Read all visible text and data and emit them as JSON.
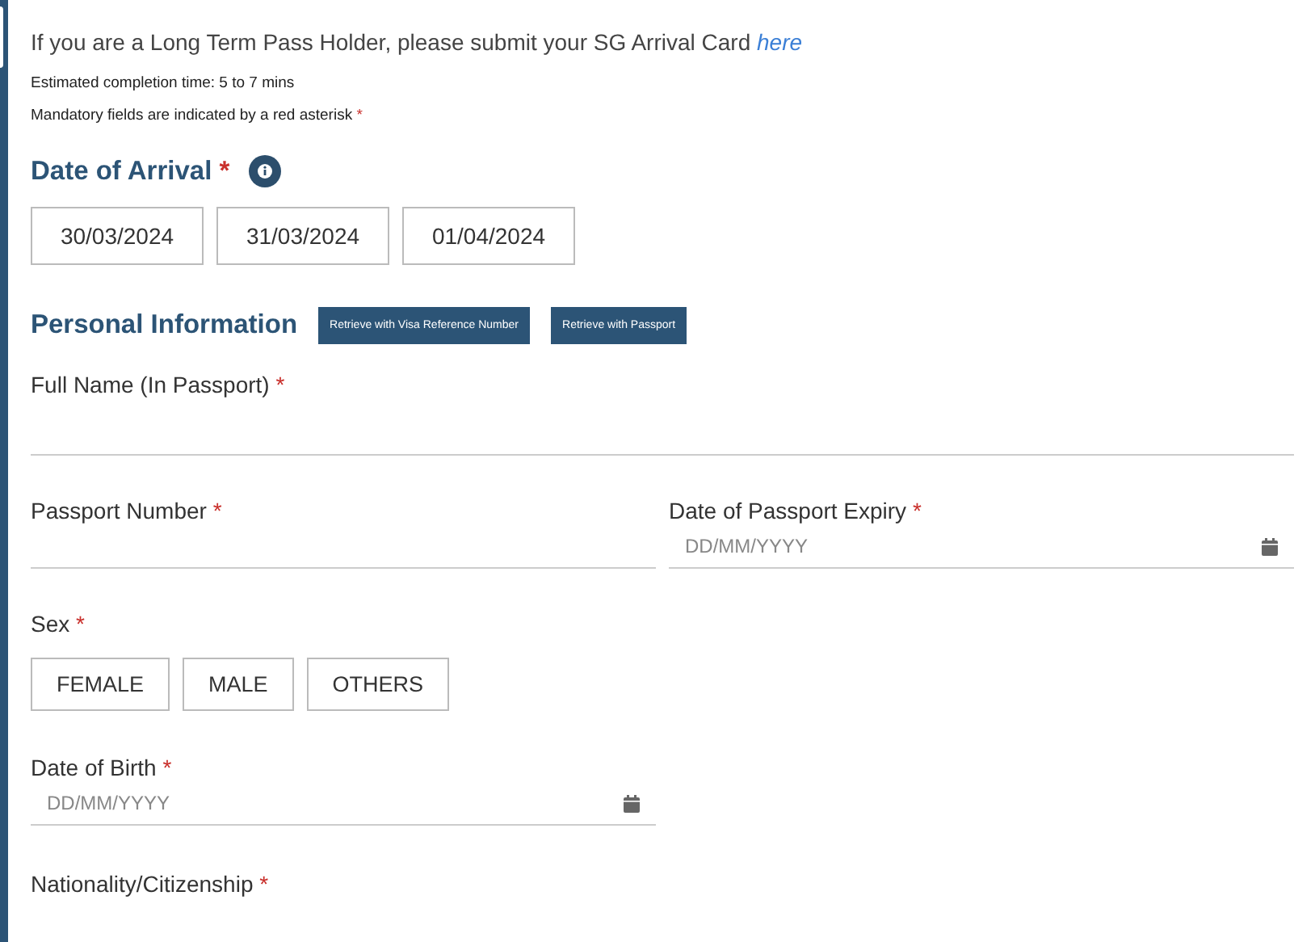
{
  "intro": {
    "text": "If you are a Long Term Pass Holder, please submit your SG Arrival Card ",
    "link": "here"
  },
  "estimate": "Estimated completion time: 5 to 7 mins",
  "mandatory_note": {
    "text": "Mandatory fields are indicated by a red asterisk",
    "mark": "*"
  },
  "arrival": {
    "title": "Date of Arrival",
    "mark": "*",
    "dates": [
      "30/03/2024",
      "31/03/2024",
      "01/04/2024"
    ]
  },
  "personal": {
    "title": "Personal Information",
    "buttons": [
      "Retrieve with Visa Reference Number",
      "Retrieve with Passport"
    ]
  },
  "full_name": {
    "label": "Full Name (In Passport)",
    "mark": "*"
  },
  "passport_number": {
    "label": "Passport Number",
    "mark": "*"
  },
  "passport_expiry": {
    "label": "Date of Passport Expiry",
    "mark": "*",
    "placeholder": "DD/MM/YYYY"
  },
  "sex": {
    "label": "Sex",
    "mark": "*",
    "options": [
      "FEMALE",
      "MALE",
      "OTHERS"
    ]
  },
  "dob": {
    "label": "Date of Birth",
    "mark": "*",
    "placeholder": "DD/MM/YYYY"
  },
  "nationality": {
    "label": "Nationality/Citizenship",
    "mark": "*"
  }
}
